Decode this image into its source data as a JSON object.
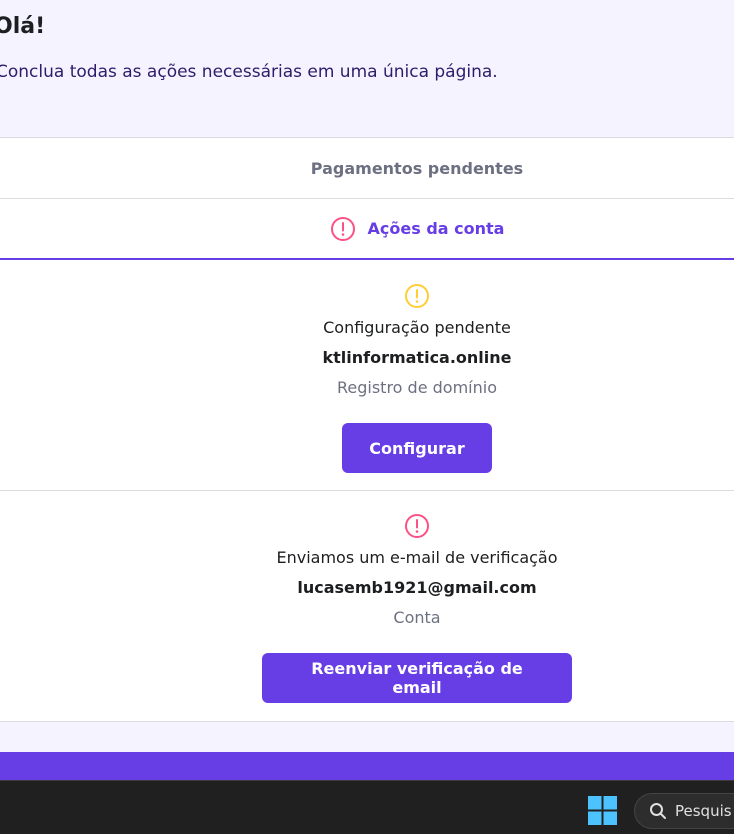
{
  "header": {
    "greeting": "Olá!",
    "subtitle": "Conclua todas as ações necessárias em uma única página."
  },
  "tabs": [
    {
      "label": "Pagamentos pendentes",
      "active": false
    },
    {
      "label": "Ações da conta",
      "active": true,
      "icon": "alert-circle-icon"
    }
  ],
  "actions": [
    {
      "icon": "alert-circle-icon",
      "icon_color": "#ffcd35",
      "title": "Configuração pendente",
      "target": "ktlinformatica.online",
      "category": "Registro de domínio",
      "button_label": "Configurar"
    },
    {
      "icon": "alert-circle-icon",
      "icon_color": "#fc5185",
      "title": "Enviamos um e-mail de verificação",
      "target": "lucasemb1921@gmail.com",
      "category": "Conta",
      "button_label": "Reenviar verificação de email"
    }
  ],
  "taskbar": {
    "start_icon": "windows-logo-icon",
    "search_placeholder": "Pesquis"
  },
  "colors": {
    "accent": "#673de6",
    "warning": "#ffcd35",
    "danger": "#fc5185",
    "page_background": "#f4f3ff"
  }
}
